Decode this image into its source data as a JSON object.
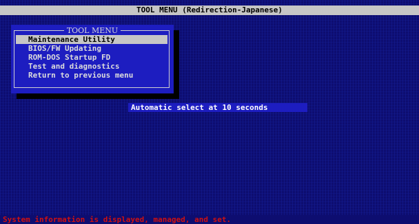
{
  "window": {
    "title": "TOOL MENU (Redirection-Japanese)"
  },
  "menu": {
    "title": "TOOL MENU",
    "selected_index": 0,
    "items": [
      {
        "label": "Maintenance Utility"
      },
      {
        "label": "BIOS/FW Updating"
      },
      {
        "label": "ROM-DOS Startup FD"
      },
      {
        "label": "Test and diagnostics"
      },
      {
        "label": "Return to previous menu"
      }
    ]
  },
  "countdown": {
    "text": "Automatic select at 10 seconds"
  },
  "status": {
    "text": "System information is displayed, managed, and set."
  },
  "colors": {
    "background": "#0d0d70",
    "panel": "#1d1dc0",
    "highlight": "#c6c6c6",
    "status_text": "#d01010"
  }
}
